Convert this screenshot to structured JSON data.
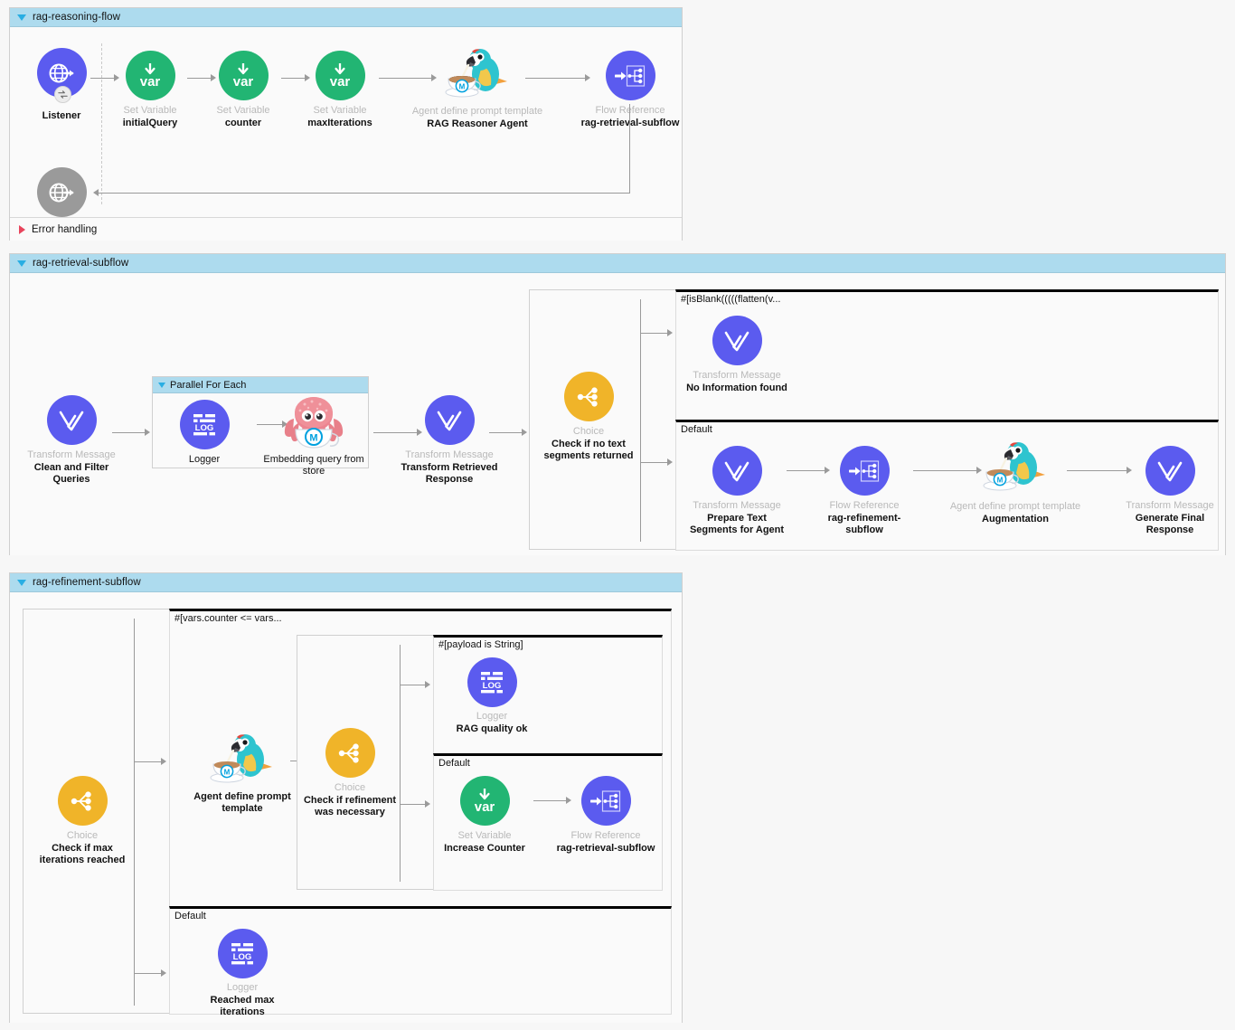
{
  "flows": [
    {
      "id": "rag-reasoning-flow",
      "title": "rag-reasoning-flow",
      "error_handling_label": "Error handling",
      "nodes": [
        {
          "type": "",
          "name": "Listener",
          "icon": "http-listener-icon"
        },
        {
          "type": "Set Variable",
          "name": "initialQuery",
          "icon": "set-variable-icon"
        },
        {
          "type": "Set Variable",
          "name": "counter",
          "icon": "set-variable-icon"
        },
        {
          "type": "Set Variable",
          "name": "maxIterations",
          "icon": "set-variable-icon"
        },
        {
          "type": "Agent define prompt template",
          "name": "RAG Reasoner Agent",
          "icon": "agent-parrot-icon"
        },
        {
          "type": "Flow Reference",
          "name": "rag-retrieval-subflow",
          "icon": "flow-reference-icon"
        },
        {
          "type": "",
          "name": "",
          "icon": "http-response-icon"
        }
      ]
    },
    {
      "id": "rag-retrieval-subflow",
      "title": "rag-retrieval-subflow",
      "nodes": [
        {
          "type": "Transform Message",
          "name": "Clean and Filter Queries",
          "icon": "transform-message-icon"
        },
        {
          "type": "Logger",
          "name": "Logger",
          "icon": "logger-icon"
        },
        {
          "type": "",
          "name": "Embedding query from store",
          "icon": "ms-einstein-octopus-icon"
        },
        {
          "type": "Transform Message",
          "name": "Transform Retrieved Response",
          "icon": "transform-message-icon"
        },
        {
          "type": "Choice",
          "name": "Check if no text segments returned",
          "icon": "choice-icon"
        },
        {
          "type": "Transform Message",
          "name": "No Information found",
          "icon": "transform-message-icon"
        },
        {
          "type": "Transform Message",
          "name": "Prepare Text Segments for Agent",
          "icon": "transform-message-icon"
        },
        {
          "type": "Flow Reference",
          "name": "rag-refinement-subflow",
          "icon": "flow-reference-icon"
        },
        {
          "type": "Agent define prompt template",
          "name": "Augmentation",
          "icon": "agent-parrot-icon"
        },
        {
          "type": "Transform Message",
          "name": "Generate Final Response",
          "icon": "transform-message-icon"
        }
      ],
      "scopes": [
        {
          "title": "Parallel For Each"
        }
      ],
      "routes": [
        {
          "label": "#[isBlank(((((flatten(v..."
        },
        {
          "label": "Default"
        }
      ]
    },
    {
      "id": "rag-refinement-subflow",
      "title": "rag-refinement-subflow",
      "nodes": [
        {
          "type": "Choice",
          "name": "Check if max iterations reached",
          "icon": "choice-icon"
        },
        {
          "type": "",
          "name": "Agent define prompt template",
          "icon": "agent-parrot-icon"
        },
        {
          "type": "Choice",
          "name": "Check if refinement was necessary",
          "icon": "choice-icon"
        },
        {
          "type": "Logger",
          "name": "RAG quality ok",
          "icon": "logger-icon"
        },
        {
          "type": "Set Variable",
          "name": "Increase Counter",
          "icon": "set-variable-icon"
        },
        {
          "type": "Flow Reference",
          "name": "rag-retrieval-subflow",
          "icon": "flow-reference-icon"
        },
        {
          "type": "Logger",
          "name": "Reached max iterations",
          "icon": "logger-icon"
        }
      ],
      "routes": [
        {
          "label": "#[vars.counter <= vars..."
        },
        {
          "label": "Default"
        },
        {
          "label": "#[payload is String]"
        },
        {
          "label": "Default"
        }
      ]
    }
  ],
  "colors": {
    "header_blue": "#addbee",
    "node_purple": "#5b5bef",
    "node_green": "#22b573",
    "node_yellow": "#f0b429",
    "node_gray": "#9a9a9a",
    "disclosure_blue": "#29aee3",
    "disclosure_red": "#e8445c",
    "canvas": "#f7f7f7",
    "panel": "#fafafa"
  },
  "labels": {
    "logger_glyph": "LOG",
    "set_variable_glyph": "var"
  }
}
